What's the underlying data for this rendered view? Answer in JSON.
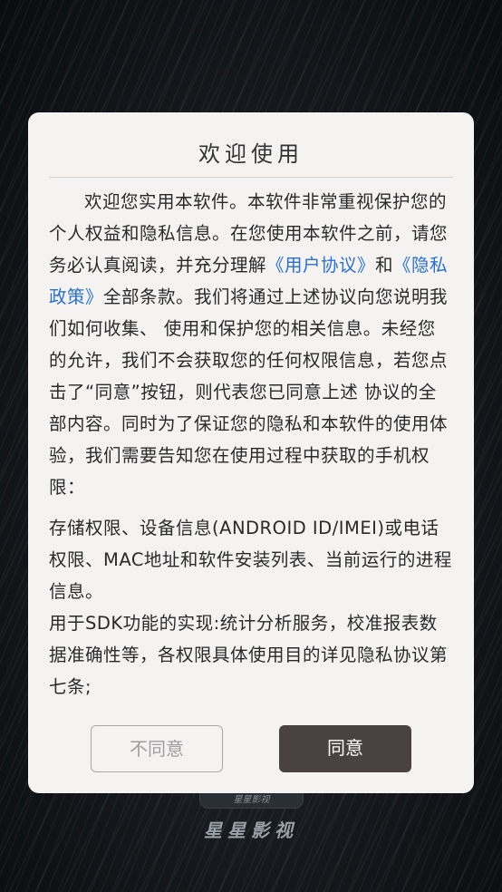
{
  "app": {
    "name": "星星影视",
    "logo_caption": "星星影视"
  },
  "dialog": {
    "title": "欢迎使用",
    "intro": {
      "p1": "欢迎您实用本软件。本软件非常重视保护您的个人权益和隐私信息。在您使用本软件之前，请您务必认真阅读，并充分理解",
      "user_agreement_link": "《用户协议》",
      "and": "和",
      "privacy_policy_link": "《隐私政策》",
      "p2": "全部条款。我们将通过上述协议向您说明我们如何收集、 使用和保护您的相关信息。未经您的允许，我们不会获取您的任何权限信息，若您点击了“同意”按钮，则代表您已同意上述 协议的全部内容。同时为了保证您的隐私和本软件的使用体验，我们需要告知您在使用过程中获取的手机权限："
    },
    "permissions": "存储权限、设备信息(ANDROID ID/IMEI)或电话权限、MAC地址和软件安装列表、当前运行的进程信息。",
    "sdk_usage": "用于SDK功能的实现:统计分析服务，校准报表数据准确性等，各权限具体使用目的详见隐私协议第七条;",
    "disagree_label": "不同意",
    "agree_label": "同意"
  }
}
